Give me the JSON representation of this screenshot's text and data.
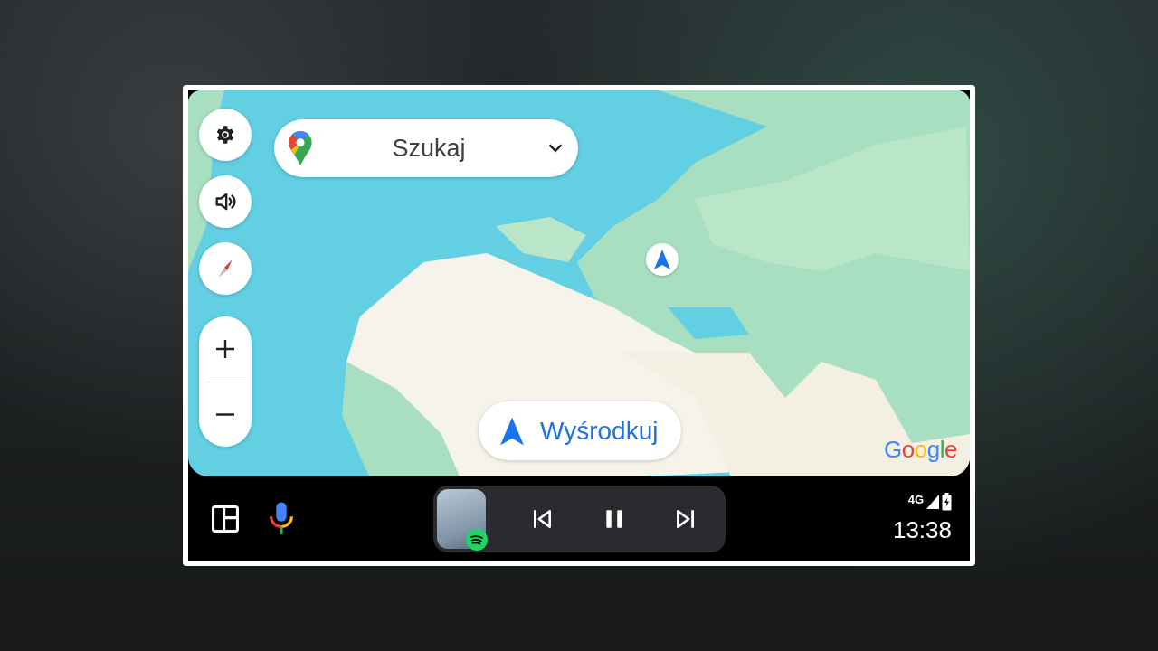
{
  "search": {
    "placeholder": "Szukaj"
  },
  "recenter_button": {
    "label": "Wyśrodkuj"
  },
  "map": {
    "attribution": "Google"
  },
  "media": {
    "playing": true
  },
  "status": {
    "network": "4G",
    "time": "13:38"
  }
}
